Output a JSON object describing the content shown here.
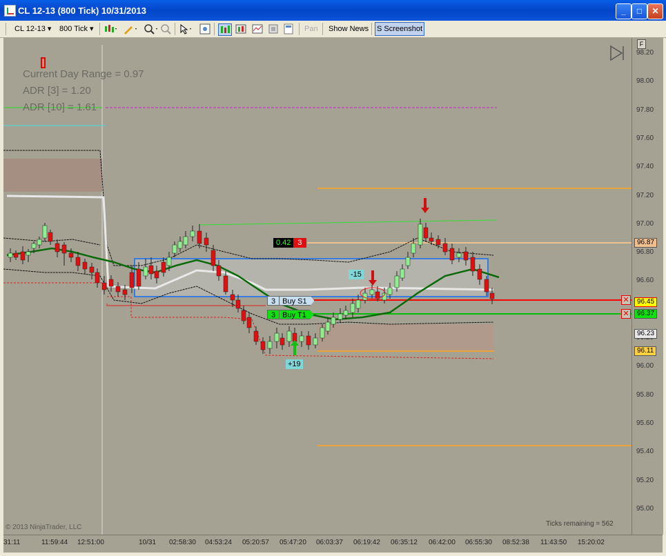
{
  "window": {
    "title": "CL 12-13 (800 Tick)  10/31/2013",
    "minimize": "_",
    "maximize": "□",
    "close": "✕"
  },
  "toolbar": {
    "instrument": "CL 12-13 ▾",
    "period": "800 Tick ▾",
    "pan": "Pan",
    "show_news": "Show News",
    "screenshot": "S Screenshot"
  },
  "chart": {
    "indicators": {
      "current_day_range": "Current Day Range = 0.97",
      "adr3": "ADR [3] = 1.20",
      "adr10": "ADR [10] = 1.61"
    },
    "copyright": "© 2013 NinjaTrader, LLC",
    "ticks_remaining": "Ticks remaining = 562",
    "order_sell_qty": "3",
    "order_sell_label": "Buy S1",
    "order_buy_qty": "3",
    "order_buy_label": "Buy T1",
    "pnl_value": "0.42",
    "pnl_qty": "3",
    "marker_neg": "-15",
    "marker_pos": "+19",
    "f_button": "F"
  },
  "price_axis": {
    "ticks": [
      "98.20",
      "98.00",
      "97.80",
      "97.60",
      "97.40",
      "97.20",
      "97.00",
      "96.80",
      "96.60",
      "96.20",
      "96.00",
      "95.80",
      "95.60",
      "95.40",
      "95.20",
      "95.00"
    ],
    "tags": {
      "t9687": "96.87",
      "t9645": "96.45",
      "t9637": "96.37",
      "t9623": "96.23",
      "t9611": "96.11"
    }
  },
  "time_axis": {
    "labels": [
      "31:11",
      "11:59:44",
      "12:51:00",
      "10/31",
      "02:58:30",
      "04:53:24",
      "05:20:57",
      "05:47:20",
      "06:03:37",
      "06:19:42",
      "06:35:12",
      "06:42:00",
      "06:55:30",
      "08:52:38",
      "11:43:50",
      "15:20:02"
    ]
  },
  "colors": {
    "chart_bg": "#a6a293",
    "up_candle": "#90ee90",
    "down_candle": "#e01010",
    "sma_green": "#0a6a0a",
    "white_line": "#e8e8e8",
    "orange": "#e8a33a",
    "magenta": "#d020d0",
    "cyan": "#40e0e0",
    "blue_box": "#3a7be0",
    "red_line": "#ff0000",
    "green_line": "#00c000"
  }
}
